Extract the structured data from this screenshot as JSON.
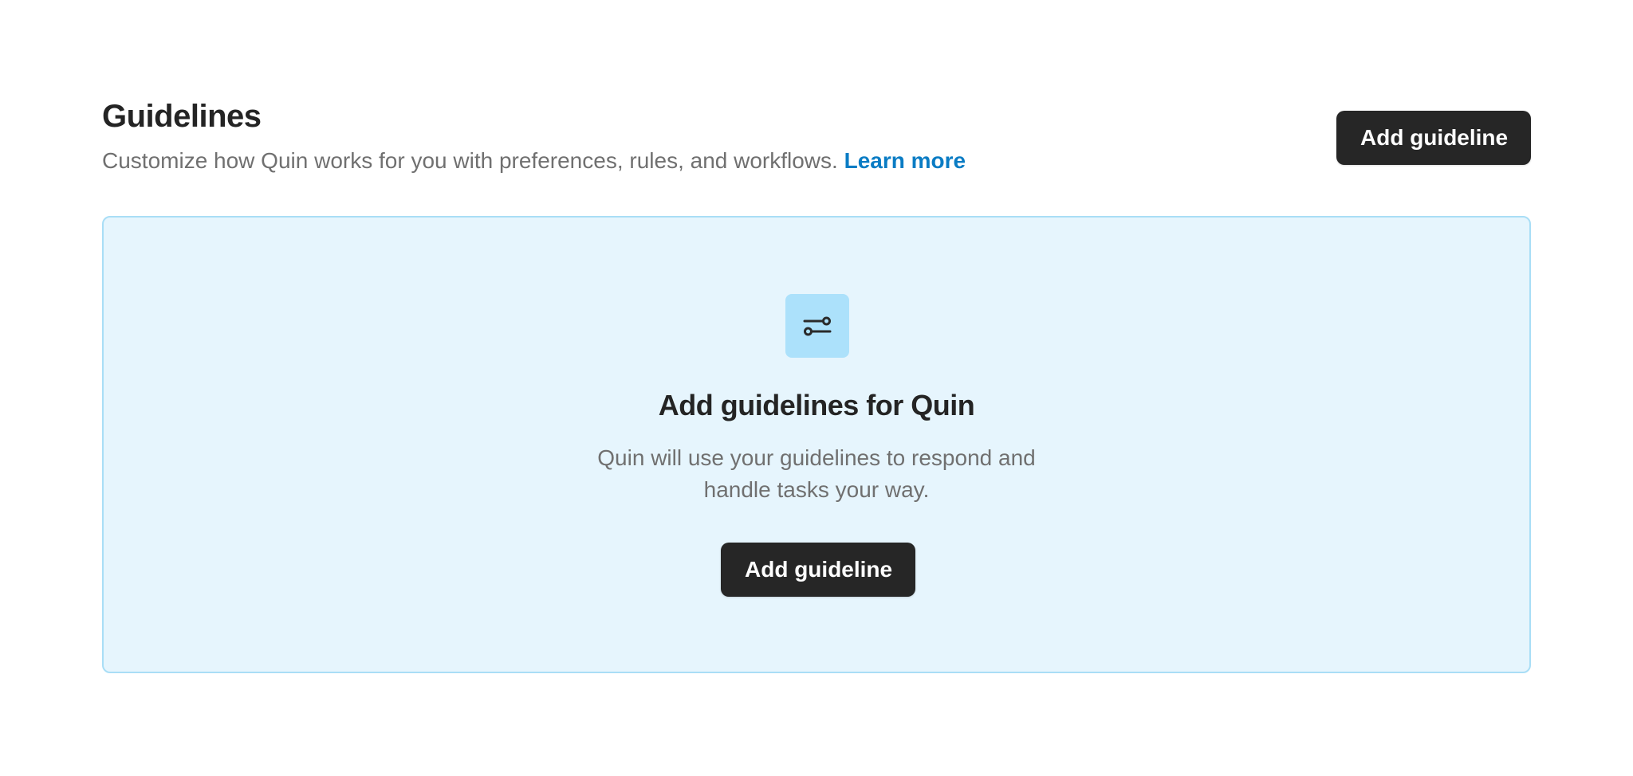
{
  "header": {
    "title": "Guidelines",
    "subtitle": "Customize how Quin works for you with preferences, rules, and workflows.",
    "learn_more_label": "Learn more",
    "add_button_label": "Add guideline"
  },
  "empty_state": {
    "icon": "sliders-icon",
    "title": "Add guidelines for Quin",
    "description": "Quin will use your guidelines to respond and handle tasks your way.",
    "add_button_label": "Add guideline"
  },
  "colors": {
    "primary_button": "#262626",
    "link": "#0a7cc4",
    "panel_background": "#e6f5fd",
    "panel_border": "#a9def6",
    "icon_background": "#ace1fb"
  }
}
